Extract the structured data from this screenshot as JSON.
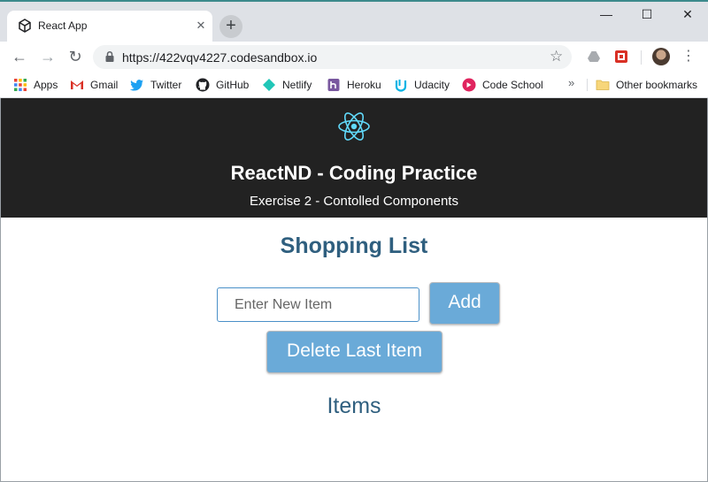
{
  "browser": {
    "tab": {
      "title": "React App",
      "close": "✕"
    },
    "new_tab": "+",
    "window_controls": {
      "minimize": "—",
      "maximize": "☐",
      "close": "✕"
    },
    "nav": {
      "back": "←",
      "forward": "→",
      "reload": "↻"
    },
    "url": "https://422vqv4227.codesandbox.io",
    "star": "☆",
    "menu": "⋮",
    "bookmarks": [
      {
        "label": "Apps",
        "icon": "apps-grid-icon"
      },
      {
        "label": "Gmail",
        "icon": "gmail-icon"
      },
      {
        "label": "Twitter",
        "icon": "twitter-icon"
      },
      {
        "label": "GitHub",
        "icon": "github-icon"
      },
      {
        "label": "Netlify",
        "icon": "netlify-icon"
      },
      {
        "label": "Heroku",
        "icon": "heroku-icon"
      },
      {
        "label": "Udacity",
        "icon": "udacity-icon"
      },
      {
        "label": "Code School",
        "icon": "codeschool-icon"
      }
    ],
    "bookmarks_more": "»",
    "other_bookmarks": "Other bookmarks"
  },
  "app": {
    "title": "ReactND - Coding Practice",
    "subtitle": "Exercise 2 - Contolled Components",
    "list_title": "Shopping List",
    "input_placeholder": "Enter New Item",
    "input_value": "",
    "add_button": "Add",
    "delete_button": "Delete Last Item",
    "items_heading": "Items"
  },
  "colors": {
    "header_bg": "#222222",
    "heading_text": "#2f5f7f",
    "button_bg": "#6aaad8",
    "react_logo": "#61dafb"
  }
}
